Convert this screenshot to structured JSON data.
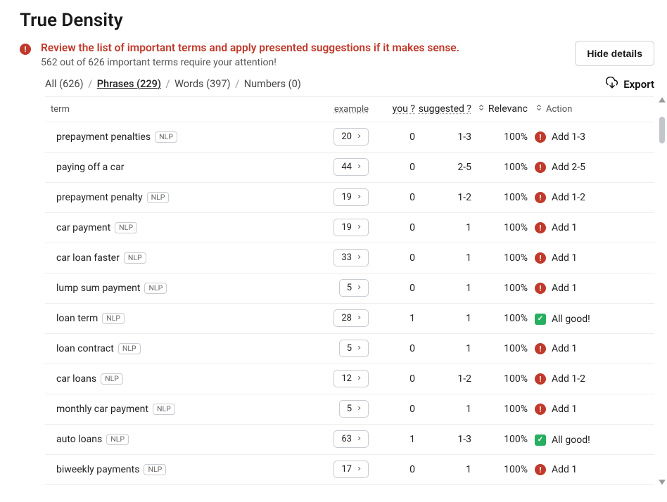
{
  "title": "True Density",
  "alert": {
    "headline": "Review the list of important terms and apply presented suggestions if it makes sense.",
    "subline": "562 out of 626 important terms require your attention!"
  },
  "hide_details_label": "Hide details",
  "filters": {
    "all": {
      "label": "All",
      "count": "626"
    },
    "phrases": {
      "label": "Phrases",
      "count": "229"
    },
    "words": {
      "label": "Words",
      "count": "397"
    },
    "numbers": {
      "label": "Numbers",
      "count": "0"
    }
  },
  "export_label": "Export",
  "columns": {
    "term": "term",
    "example": "example",
    "you": "you ?",
    "suggested": "suggested ?",
    "relevance": "Relevanc",
    "action": "Action"
  },
  "nlp_badge": "NLP",
  "rows": [
    {
      "term": "prepayment penalties",
      "nlp": true,
      "example": "20",
      "you": "0",
      "suggested": "1-3",
      "relevance": "100%",
      "status": "alert",
      "action": "Add 1-3"
    },
    {
      "term": "paying off a car",
      "nlp": false,
      "example": "44",
      "you": "0",
      "suggested": "2-5",
      "relevance": "100%",
      "status": "alert",
      "action": "Add 2-5"
    },
    {
      "term": "prepayment penalty",
      "nlp": true,
      "example": "19",
      "you": "0",
      "suggested": "1-2",
      "relevance": "100%",
      "status": "alert",
      "action": "Add 1-2"
    },
    {
      "term": "car payment",
      "nlp": true,
      "example": "19",
      "you": "0",
      "suggested": "1",
      "relevance": "100%",
      "status": "alert",
      "action": "Add 1"
    },
    {
      "term": "car loan faster",
      "nlp": true,
      "example": "33",
      "you": "0",
      "suggested": "1",
      "relevance": "100%",
      "status": "alert",
      "action": "Add 1"
    },
    {
      "term": "lump sum payment",
      "nlp": true,
      "example": "5",
      "you": "0",
      "suggested": "1",
      "relevance": "100%",
      "status": "alert",
      "action": "Add 1"
    },
    {
      "term": "loan term",
      "nlp": true,
      "example": "28",
      "you": "1",
      "suggested": "1",
      "relevance": "100%",
      "status": "good",
      "action": "All good!"
    },
    {
      "term": "loan contract",
      "nlp": true,
      "example": "5",
      "you": "0",
      "suggested": "1",
      "relevance": "100%",
      "status": "alert",
      "action": "Add 1"
    },
    {
      "term": "car loans",
      "nlp": true,
      "example": "12",
      "you": "0",
      "suggested": "1-2",
      "relevance": "100%",
      "status": "alert",
      "action": "Add 1-2"
    },
    {
      "term": "monthly car payment",
      "nlp": true,
      "example": "5",
      "you": "0",
      "suggested": "1",
      "relevance": "100%",
      "status": "alert",
      "action": "Add 1"
    },
    {
      "term": "auto loans",
      "nlp": true,
      "example": "63",
      "you": "1",
      "suggested": "1-3",
      "relevance": "100%",
      "status": "good",
      "action": "All good!"
    },
    {
      "term": "biweekly payments",
      "nlp": true,
      "example": "17",
      "you": "0",
      "suggested": "1",
      "relevance": "100%",
      "status": "alert",
      "action": "Add 1"
    }
  ]
}
